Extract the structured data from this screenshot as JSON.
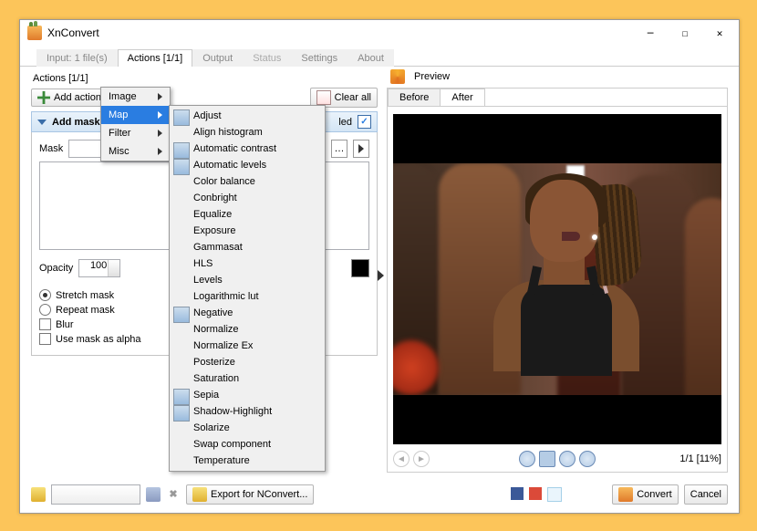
{
  "window": {
    "title": "XnConvert"
  },
  "tabs": {
    "items": [
      "Input: 1 file(s)",
      "Actions [1/1]",
      "Output",
      "Status",
      "Settings",
      "About"
    ],
    "active": 1
  },
  "actions": {
    "header": "Actions [1/1]",
    "add_label": "Add action>",
    "clear_label": "Clear all",
    "item": {
      "name": "Add mask",
      "enabled_label": "led",
      "mask_label": "Mask",
      "opacity_label": "Opacity",
      "opacity_value": "100",
      "stretch": "Stretch mask",
      "repeat": "Repeat mask",
      "blur": "Blur",
      "use_alpha": "Use mask as alpha"
    }
  },
  "menu": {
    "cats": [
      "Image",
      "Map",
      "Filter",
      "Misc"
    ],
    "map_items": [
      "Adjust",
      "Align histogram",
      "Automatic contrast",
      "Automatic levels",
      "Color balance",
      "Conbright",
      "Equalize",
      "Exposure",
      "Gammasat",
      "HLS",
      "Levels",
      "Logarithmic lut",
      "Negative",
      "Normalize",
      "Normalize Ex",
      "Posterize",
      "Saturation",
      "Sepia",
      "Shadow-Highlight",
      "Solarize",
      "Swap component",
      "Temperature"
    ]
  },
  "preview": {
    "title": "Preview",
    "before": "Before",
    "after": "After",
    "page": "1/1 [11%]"
  },
  "footer": {
    "export": "Export for NConvert...",
    "convert": "Convert",
    "cancel": "Cancel"
  }
}
